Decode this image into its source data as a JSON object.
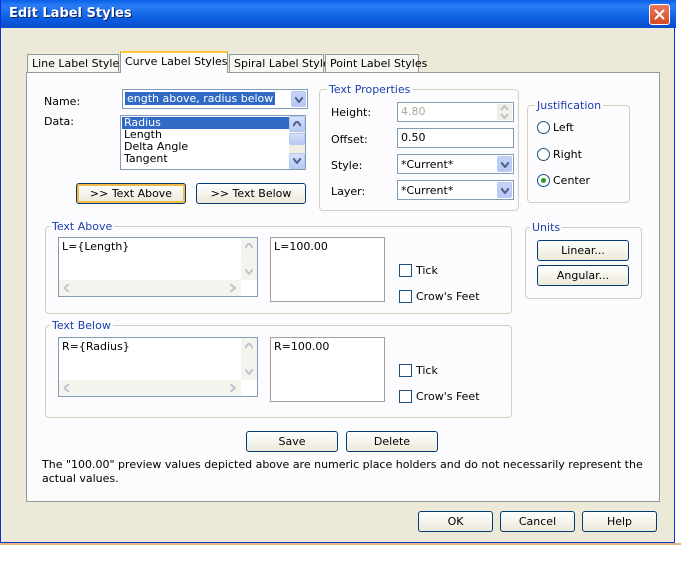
{
  "window": {
    "title": "Edit Label Styles"
  },
  "tabs": [
    {
      "label": "Line Label Styles"
    },
    {
      "label": "Curve Label Styles"
    },
    {
      "label": "Spiral Label Styles"
    },
    {
      "label": "Point Label Styles"
    }
  ],
  "name_field": {
    "label": "Name:",
    "value": "ength above, radius below"
  },
  "data_field": {
    "label": "Data:",
    "options": [
      "Radius",
      "Length",
      "Delta Angle",
      "Tangent"
    ],
    "selected": "Radius"
  },
  "buttons": {
    "text_above": ">> Text Above",
    "text_below": ">> Text Below",
    "save": "Save",
    "delete": "Delete",
    "ok": "OK",
    "cancel": "Cancel",
    "help": "Help",
    "linear": "Linear...",
    "angular": "Angular..."
  },
  "text_properties": {
    "legend": "Text Properties",
    "height": {
      "label": "Height:",
      "value": "4.80"
    },
    "offset": {
      "label": "Offset:",
      "value": "0.50"
    },
    "style": {
      "label": "Style:",
      "value": "*Current*"
    },
    "layer": {
      "label": "Layer:",
      "value": "*Current*"
    }
  },
  "justification": {
    "legend": "Justification",
    "options": [
      "Left",
      "Right",
      "Center"
    ],
    "selected": "Center"
  },
  "units": {
    "legend": "Units"
  },
  "text_above": {
    "legend": "Text Above",
    "expression": "L={Length}",
    "preview": "L=100.00",
    "tick": "Tick",
    "crows_feet": "Crow's Feet"
  },
  "text_below": {
    "legend": "Text Below",
    "expression": "R={Radius}",
    "preview": "R=100.00",
    "tick": "Tick",
    "crows_feet": "Crow's Feet"
  },
  "note": "The \"100.00\" preview values depicted above are numeric place holders and do not necessarily represent the actual values.",
  "colors": {
    "title_bar": "#0a5ee8",
    "selection": "#316ac5",
    "legend_text": "#1a3fa9",
    "active_tab_accent": "#ffc83c",
    "close_button": "#d44a22",
    "dialog_bg": "#ece9d8"
  }
}
